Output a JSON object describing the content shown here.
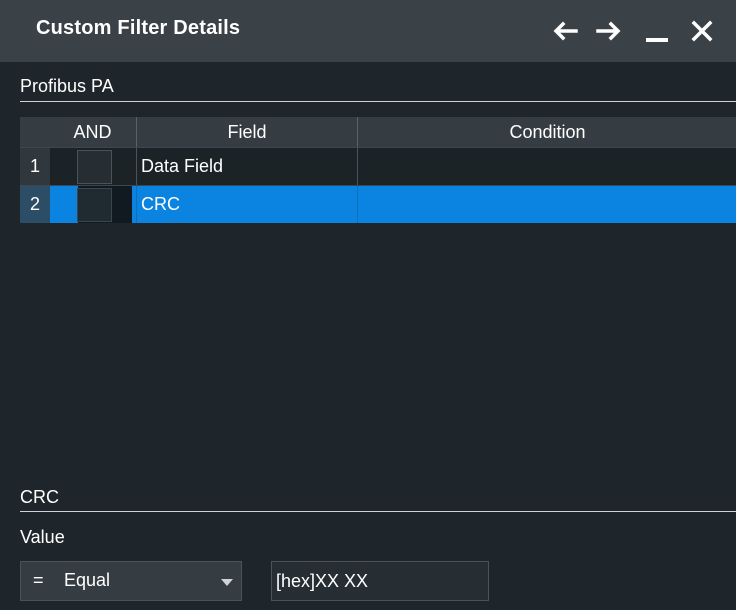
{
  "window": {
    "title": "Custom Filter Details",
    "controls": [
      {
        "name": "back-arrow-icon",
        "glyph": "←"
      },
      {
        "name": "forward-arrow-icon",
        "glyph": "→"
      },
      {
        "name": "minimize-icon",
        "glyph": "_"
      },
      {
        "name": "close-icon",
        "glyph": "✕"
      }
    ]
  },
  "protocol_section": {
    "label": "Profibus PA"
  },
  "table": {
    "headers": {
      "and": "AND",
      "field": "Field",
      "condition": "Condition"
    },
    "rows": [
      {
        "index": "1",
        "and_checked": false,
        "field": "Data Field",
        "condition": "",
        "selected": false
      },
      {
        "index": "2",
        "and_checked": false,
        "field": "CRC",
        "condition": "",
        "selected": true
      }
    ]
  },
  "detail_section": {
    "label": "CRC",
    "value_label": "Value",
    "operator_symbol": "=",
    "operator": "Equal",
    "value": "[hex]XX XX"
  },
  "colors": {
    "title_bar": "#3a4147",
    "background": "#1f262b",
    "selected_row": "#0a84e0"
  }
}
